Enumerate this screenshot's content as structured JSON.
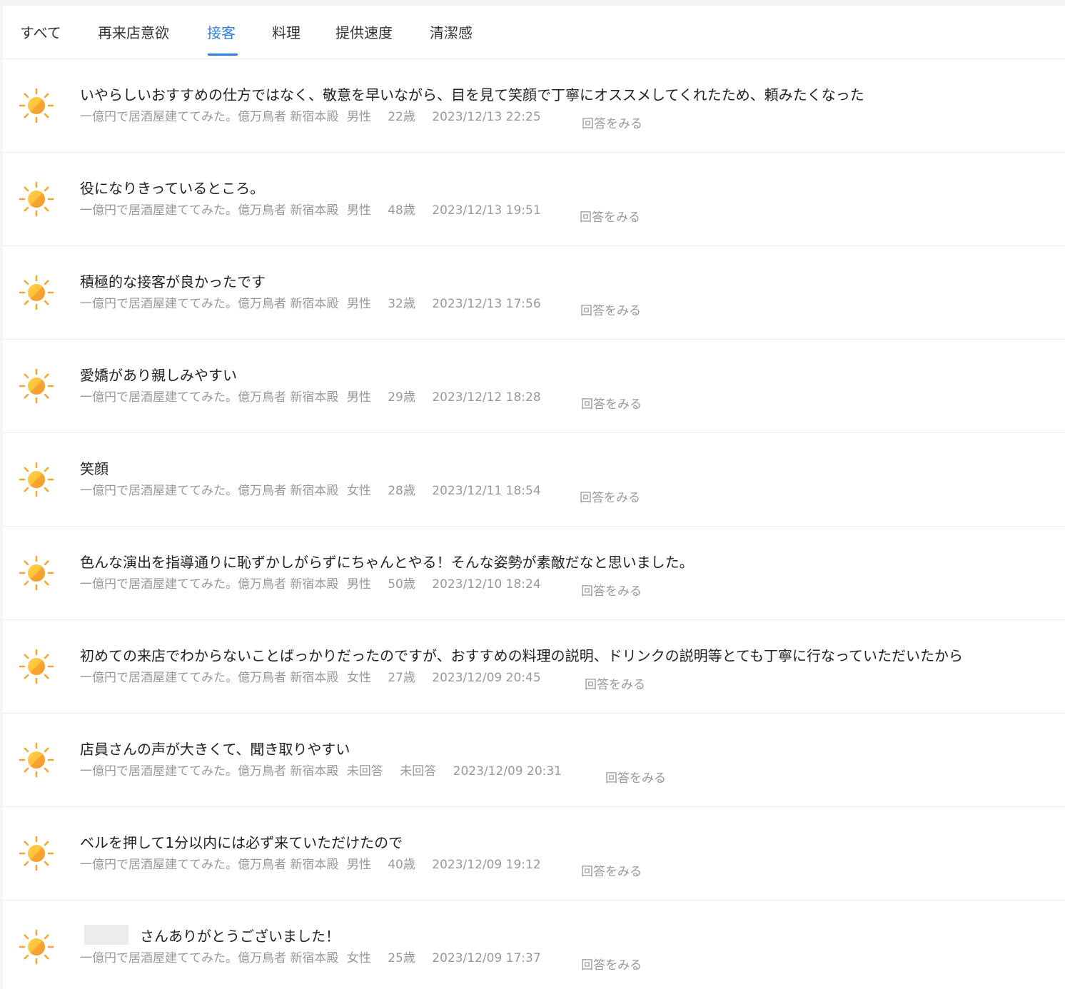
{
  "tabs": [
    {
      "label": "すべて"
    },
    {
      "label": "再来店意欲"
    },
    {
      "label": "接客"
    },
    {
      "label": "料理"
    },
    {
      "label": "提供速度"
    },
    {
      "label": "清潔感"
    }
  ],
  "active_tab": "接客",
  "accent_color": "#2f7fe0",
  "icon": "sun-icon",
  "reviews": [
    {
      "comment": "いやらしいおすすめの仕方ではなく、敬意を早いながら、目を見て笑顔で丁寧にオススメしてくれたため、頼みたくなった",
      "shop": "一億円で居酒屋建ててみた。億万鳥者 新宿本殿",
      "gender": "男性",
      "age": "22歳",
      "datetime": "2023/12/13 22:25",
      "action": "回答をみる"
    },
    {
      "comment": "役になりきっているところ。",
      "shop": "一億円で居酒屋建ててみた。億万鳥者 新宿本殿",
      "gender": "男性",
      "age": "48歳",
      "datetime": "2023/12/13 19:51",
      "action": "回答をみる"
    },
    {
      "comment": "積極的な接客が良かったです",
      "shop": "一億円で居酒屋建ててみた。億万鳥者 新宿本殿",
      "gender": "男性",
      "age": "32歳",
      "datetime": "2023/12/13 17:56",
      "action": "回答をみる"
    },
    {
      "comment": "愛嬌があり親しみやすい",
      "shop": "一億円で居酒屋建ててみた。億万鳥者 新宿本殿",
      "gender": "男性",
      "age": "29歳",
      "datetime": "2023/12/12 18:28",
      "action": "回答をみる"
    },
    {
      "comment": "笑顔",
      "shop": "一億円で居酒屋建ててみた。億万鳥者 新宿本殿",
      "gender": "女性",
      "age": "28歳",
      "datetime": "2023/12/11 18:54",
      "action": "回答をみる"
    },
    {
      "comment": "色んな演出を指導通りに恥ずかしがらずにちゃんとやる！そんな姿勢が素敵だなと思いました。",
      "shop": "一億円で居酒屋建ててみた。億万鳥者 新宿本殿",
      "gender": "男性",
      "age": "50歳",
      "datetime": "2023/12/10 18:24",
      "action": "回答をみる"
    },
    {
      "comment": "初めての来店でわからないことばっかりだったのですが、おすすめの料理の説明、ドリンクの説明等とても丁寧に行なっていただいたから",
      "shop": "一億円で居酒屋建ててみた。億万鳥者 新宿本殿",
      "gender": "女性",
      "age": "27歳",
      "datetime": "2023/12/09 20:45",
      "action": "回答をみる"
    },
    {
      "comment": "店員さんの声が大きくて、聞き取りやすい",
      "shop": "一億円で居酒屋建ててみた。億万鳥者 新宿本殿",
      "gender": "未回答",
      "age": "未回答",
      "datetime": "2023/12/09 20:31",
      "action": "回答をみる"
    },
    {
      "comment": "ベルを押して1分以内には必ず来ていただけたので",
      "shop": "一億円で居酒屋建ててみた。億万鳥者 新宿本殿",
      "gender": "男性",
      "age": "40歳",
      "datetime": "2023/12/09 19:12",
      "action": "回答をみる"
    },
    {
      "comment": "さんありがとうございました！",
      "shop": "一億円で居酒屋建ててみた。億万鳥者 新宿本殿",
      "gender": "女性",
      "age": "25歳",
      "datetime": "2023/12/09 17:37",
      "action": "回答をみる"
    }
  ]
}
